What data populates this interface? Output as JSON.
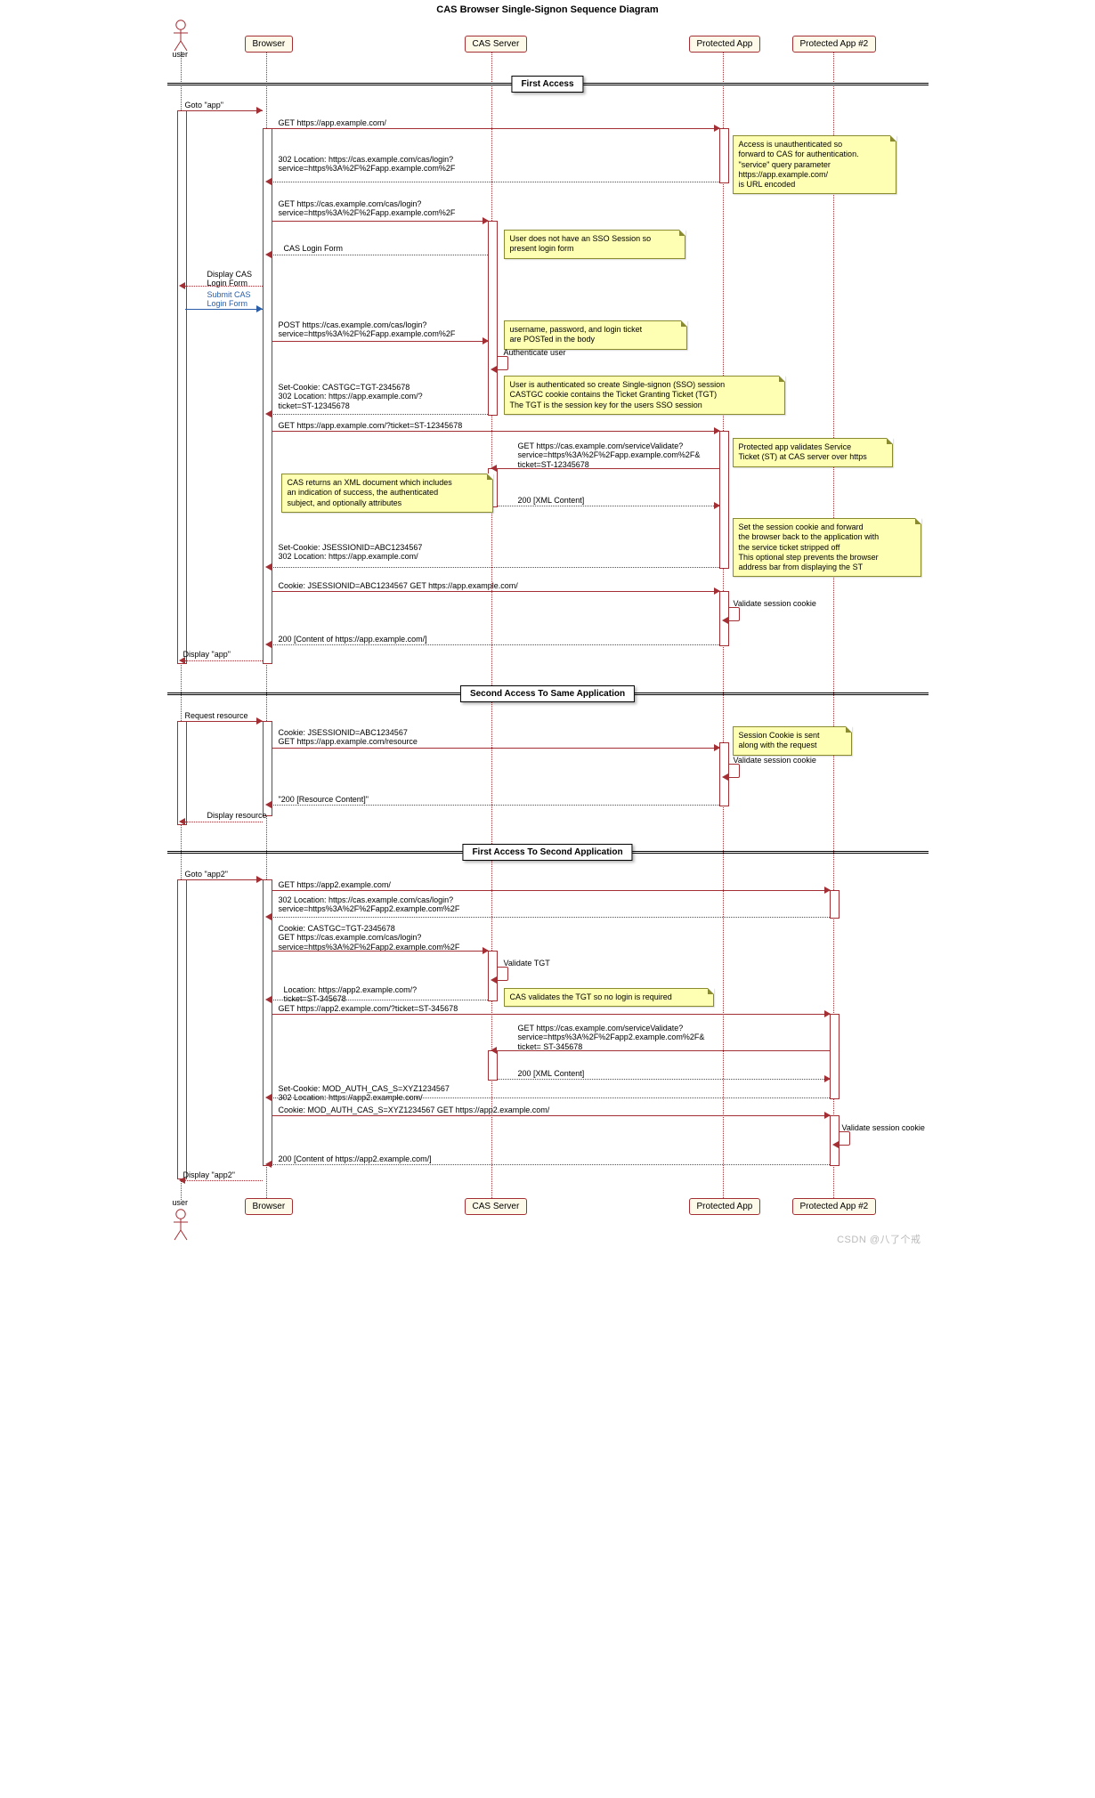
{
  "title": "CAS Browser Single-Signon Sequence Diagram",
  "actors": {
    "user": "user"
  },
  "participants": {
    "browser": "Browser",
    "cas": "CAS Server",
    "app": "Protected App",
    "app2": "Protected App #2"
  },
  "dividers": {
    "first": "First Access",
    "second": "Second Access To Same Application",
    "third": "First Access To Second Application"
  },
  "m": {
    "goto_app": "Goto \"app\"",
    "get_app": "GET https://app.example.com/",
    "redir_cas": "302 Location: https://cas.example.com/cas/login?\nservice=https%3A%2F%2Fapp.example.com%2F",
    "get_cas": "GET https://cas.example.com/cas/login?\nservice=https%3A%2F%2Fapp.example.com%2F",
    "login_form": "CAS Login Form",
    "display_login": "Display CAS\nLogin Form",
    "submit_login": "Submit CAS\nLogin Form",
    "post_cas": "POST https://cas.example.com/cas/login?\nservice=https%3A%2F%2Fapp.example.com%2F",
    "auth_user": "Authenticate user",
    "set_tgt": "Set-Cookie: CASTGC=TGT-2345678\n302 Location: https://app.example.com/?\nticket=ST-12345678",
    "get_app_st": "GET https://app.example.com/?ticket=ST-12345678",
    "svc_validate": "GET https://cas.example.com/serviceValidate?\nservice=https%3A%2F%2Fapp.example.com%2F&\nticket=ST-12345678",
    "xml_200": "200 [XML Content]",
    "set_jsid": "Set-Cookie: JSESSIONID=ABC1234567\n302 Location: https://app.example.com/",
    "cookie_jsid": "Cookie: JSESSIONID=ABC1234567 GET https://app.example.com/",
    "validate_cookie": "Validate session cookie",
    "content_app": "200 [Content of https://app.example.com/]",
    "display_app": "Display \"app\"",
    "req_res": "Request resource",
    "cookie_res": "Cookie: JSESSIONID=ABC1234567\nGET https://app.example.com/resource",
    "res_200": "\"200 [Resource Content]\"",
    "display_res": "Display resource",
    "goto_app2": "Goto \"app2\"",
    "get_app2": "GET https://app2.example.com/",
    "redir_cas2": "302 Location: https://cas.example.com/cas/login?\nservice=https%3A%2F%2Fapp2.example.com%2F",
    "cookie_tgt_get": "Cookie: CASTGC=TGT-2345678\nGET https://cas.example.com/cas/login?\nservice=https%3A%2F%2Fapp2.example.com%2F",
    "validate_tgt": "Validate TGT",
    "loc_app2_st": "Location: https://app2.example.com/?\nticket=ST-345678",
    "get_app2_st": "GET https://app2.example.com/?ticket=ST-345678",
    "svc_validate2": "GET https://cas.example.com/serviceValidate?\nservice=https%3A%2F%2Fapp2.example.com%2F&\nticket= ST-345678",
    "set_mod": "Set-Cookie: MOD_AUTH_CAS_S=XYZ1234567\n302 Location: https://app2.example.com/",
    "cookie_mod": "Cookie: MOD_AUTH_CAS_S=XYZ1234567 GET https://app2.example.com/",
    "content_app2": "200 [Content of https://app2.example.com/]",
    "display_app2": "Display \"app2\""
  },
  "n": {
    "n1": "Access is unauthenticated so\nforward to CAS for authentication.\n\"service\" query parameter\nhttps://app.example.com/\nis URL encoded",
    "n2": "User does not have an SSO Session so\npresent login form",
    "n3": "username, password, and login ticket\nare POSTed in the body",
    "n4": "User is authenticated so create Single-signon (SSO) session\nCASTGC cookie contains the Ticket Granting Ticket (TGT)\nThe TGT is the session key for the users SSO session",
    "n5": "Protected app validates Service\nTicket (ST) at CAS server over https",
    "n6": "CAS returns an XML document which includes\nan indication of success, the authenticated\nsubject, and optionally attributes",
    "n7": "Set the session cookie and forward\nthe browser back to the application with\nthe service ticket stripped off\nThis optional step prevents the browser\naddress bar from displaying the ST",
    "n8": "Session Cookie is sent\nalong with the request",
    "n9": "CAS validates the TGT so no login is required"
  },
  "watermark": "CSDN @八了个戒"
}
